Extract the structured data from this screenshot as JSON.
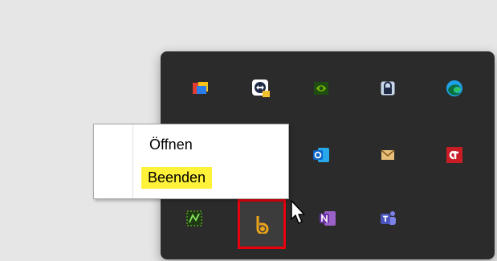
{
  "context_menu": {
    "items": [
      {
        "label": "Öffnen",
        "highlighted": false
      },
      {
        "label": "Beenden",
        "highlighted": true
      }
    ],
    "highlight_color": "#fff238"
  },
  "tray": {
    "background": "#2b2b2b",
    "icons": [
      {
        "name": "colorful-app-icon"
      },
      {
        "name": "teamviewer-icon"
      },
      {
        "name": "nvidia-icon"
      },
      {
        "name": "keepass-lock-icon"
      },
      {
        "name": "edge-icon"
      },
      {
        "name": "outlook-icon"
      },
      {
        "name": "mail-icon"
      },
      {
        "name": "ct-icon"
      },
      {
        "name": "greenshot-icon"
      },
      {
        "name": "yellow-b-app-icon",
        "selected": true
      },
      {
        "name": "onenote-icon"
      },
      {
        "name": "teams-icon"
      }
    ],
    "selection_outline_color": "#e8000d"
  }
}
